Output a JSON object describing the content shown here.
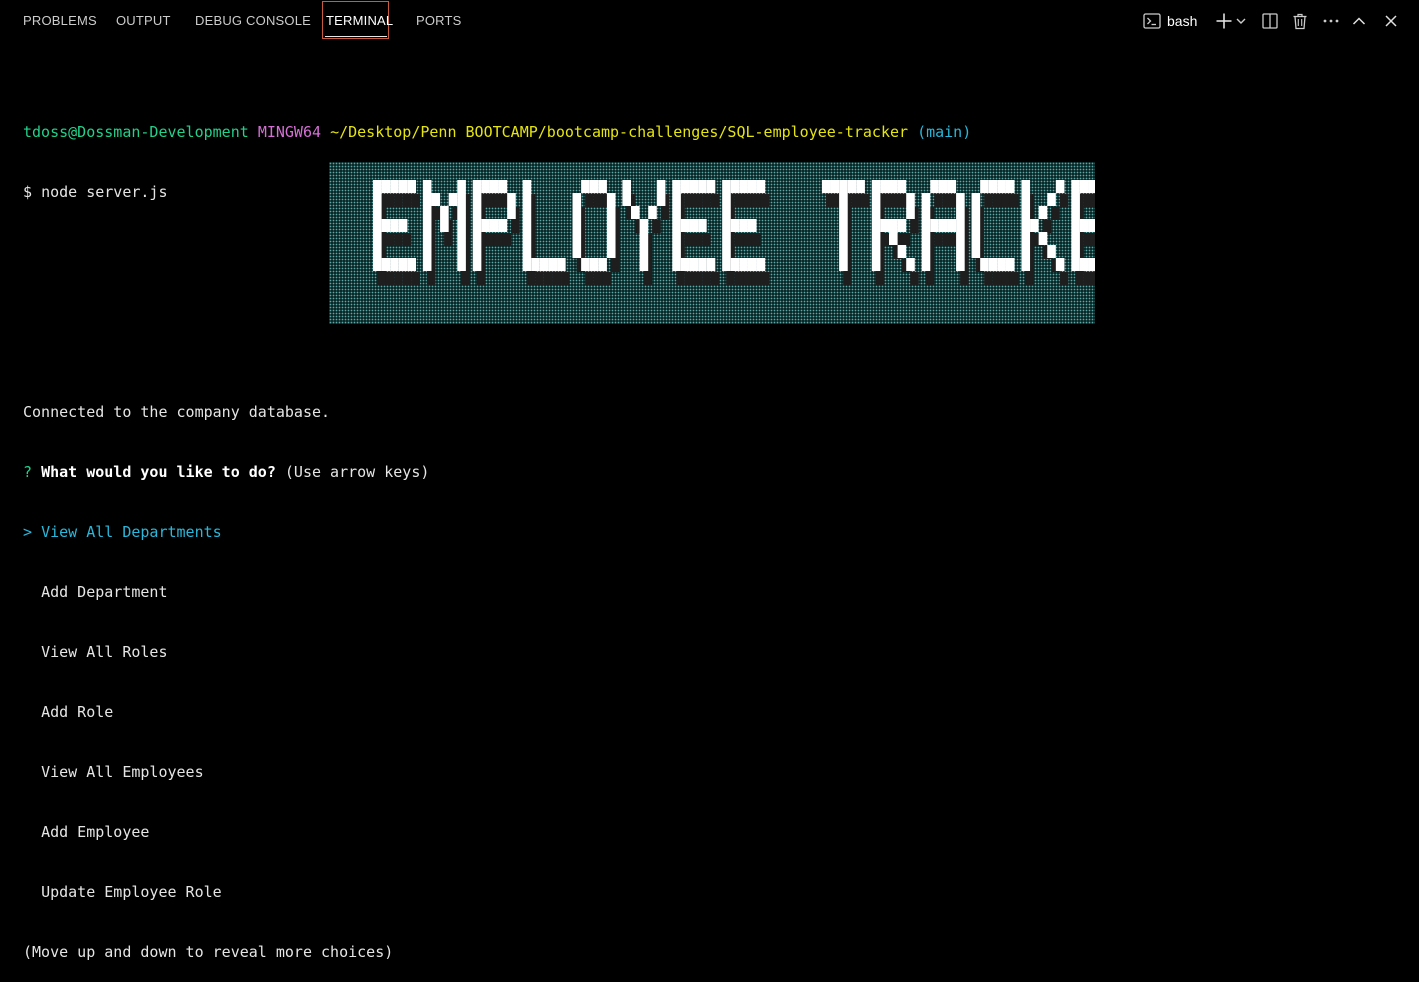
{
  "panel": {
    "tabs": [
      {
        "label": "PROBLEMS"
      },
      {
        "label": "OUTPUT"
      },
      {
        "label": "DEBUG CONSOLE"
      },
      {
        "label": "TERMINAL"
      },
      {
        "label": "PORTS"
      }
    ],
    "active_tab": "TERMINAL",
    "terminal_name": "bash",
    "icons": [
      "terminal-icon",
      "plus-icon",
      "chevron-down-icon",
      "split-icon",
      "trash-icon",
      "more-icon",
      "chevron-up-icon",
      "close-icon"
    ]
  },
  "prompt": {
    "user_host": "tdoss@Dossman-Development",
    "shell": "MINGW64",
    "path": "~/Desktop/Penn BOOTCAMP/bootcamp-challenges/SQL-employee-tracker",
    "branch": "(main)",
    "dollar": "$",
    "command": "node server.js"
  },
  "banner": {
    "text": "EMPLOYEE TRACKER"
  },
  "output": {
    "connected": "Connected to the company database.",
    "question_mark": "?",
    "question": "What would you like to do?",
    "hint": "(Use arrow keys)",
    "pointer": ">",
    "choices": [
      "View All Departments",
      "Add Department",
      "View All Roles",
      "Add Role",
      "View All Employees",
      "Add Employee",
      "Update Employee Role"
    ],
    "selected_index": 0,
    "more": "(Move up and down to reveal more choices)"
  },
  "colors": {
    "background": "#000000",
    "green": "#23d18b",
    "magenta": "#d670d6",
    "yellow": "#e5e510",
    "cyan": "#29b8db",
    "active_tab_border": "#c75a3f"
  }
}
